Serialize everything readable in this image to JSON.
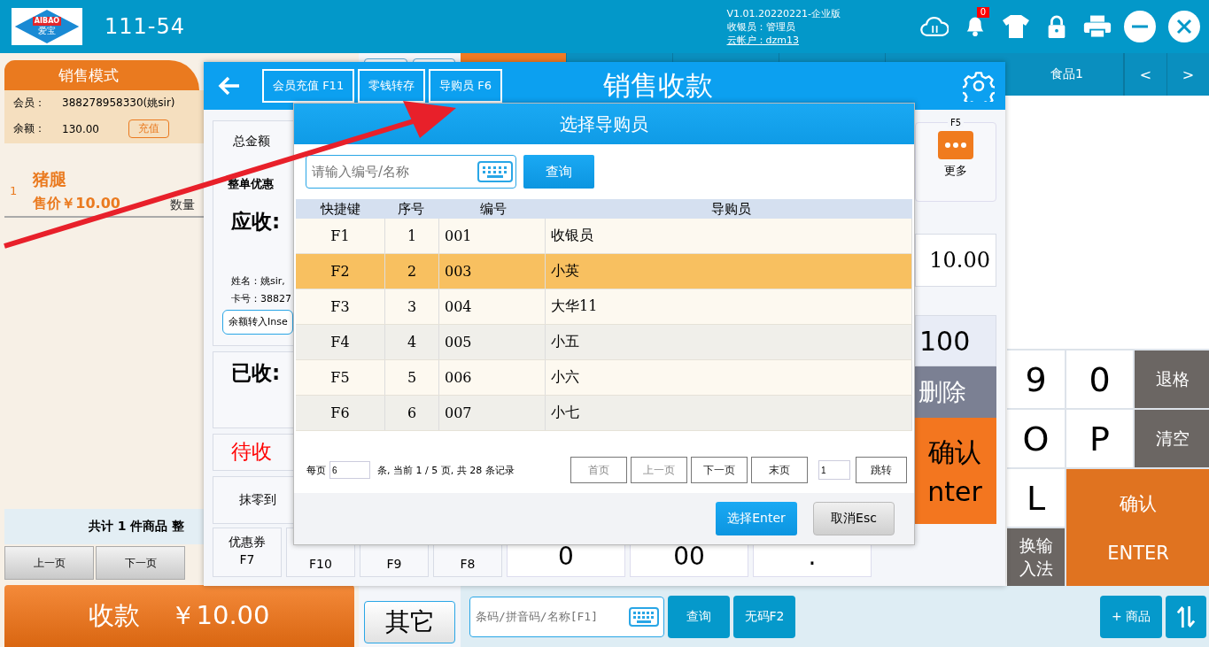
{
  "header": {
    "logo_text": "AIBAO",
    "logo_subtext": "爱宝",
    "title": "111-54",
    "version": "V1.01.20220221-企业版",
    "cashier": "收银员：管理员",
    "cloud_account": "云帐户：dzm13",
    "notification_count": "0"
  },
  "sale_panel": {
    "mode_tab": "销售模式",
    "member_label": "会员：",
    "member_value": "388278958330(姚sir)",
    "balance_label": "余额：",
    "balance_value": "130.00",
    "recharge_button": "充值",
    "items": [
      {
        "index": "1",
        "name": "猪腿",
        "price": "售价￥10.00",
        "qty_label": "数量"
      }
    ],
    "summary": "共计 1 件商品 整",
    "page_buttons": [
      "上一页",
      "下一页"
    ],
    "pay_button": {
      "label": "收款",
      "amount": "￥10.00"
    }
  },
  "side_buttons": [
    "其它"
  ],
  "category_tabs": [
    {
      "selected": true
    },
    {
      "selected": false
    },
    {
      "selected": false
    },
    {
      "selected": false
    },
    {
      "label": "食品1",
      "selected": false
    }
  ],
  "category_nav": [
    "<",
    ">"
  ],
  "keypad": [
    {
      "kind": "char",
      "label": "9"
    },
    {
      "kind": "char",
      "label": "0"
    },
    {
      "kind": "action",
      "label": "退格"
    },
    {
      "kind": "char",
      "label": "O"
    },
    {
      "kind": "char",
      "label": "P"
    },
    {
      "kind": "action",
      "label": "清空"
    },
    {
      "kind": "char",
      "label": "L"
    },
    {
      "kind": "confirm",
      "lines": [
        "确认",
        "ENTER"
      ]
    },
    {
      "kind": "action",
      "label": "换输入法"
    }
  ],
  "bottom_bar": {
    "search_placeholder": "条码/拼音码/名称[F1]",
    "query_button": "查询",
    "no_code_button": "无码F2",
    "add_button": "+ 商品"
  },
  "payment_window": {
    "title": "销售收款",
    "toolbar_buttons": [
      "会员充值 F11",
      "零钱转存",
      "导购员 F6"
    ],
    "total_label": "总金额",
    "discount_label": "整单优惠",
    "receivable_label": "应收:",
    "member_name": "姓名：姚sir,",
    "card_no": "卡号：38827",
    "balance_transfer_button": "余额转入Inse",
    "received_label": "已收:",
    "pending_label": "待收",
    "round_label": "抹零到",
    "function_keys": [
      {
        "label": "优惠券",
        "key": "F7"
      },
      {
        "key": "F10"
      },
      {
        "key": "F9"
      },
      {
        "key": "F8"
      }
    ],
    "more_button": {
      "key": "F5",
      "label": "更多"
    },
    "amount_value": "10.00",
    "quick_amount": "100",
    "delete_key": "删除",
    "confirm_key": [
      "确认",
      "nter"
    ],
    "keypad_row": [
      "0",
      "00",
      "."
    ]
  },
  "dialog": {
    "title": "选择导购员",
    "search_placeholder": "请输入编号/名称",
    "search_button": "查询",
    "columns": [
      "快捷键",
      "序号",
      "编号",
      "导购员"
    ],
    "rows": [
      {
        "cells": [
          "F1",
          "1",
          "001",
          "收银员"
        ],
        "selected": false
      },
      {
        "cells": [
          "F2",
          "2",
          "003",
          "小英"
        ],
        "selected": true
      },
      {
        "cells": [
          "F3",
          "3",
          "004",
          "大华11"
        ],
        "selected": false
      },
      {
        "cells": [
          "F4",
          "4",
          "005",
          "小五"
        ],
        "selected": false
      },
      {
        "cells": [
          "F5",
          "5",
          "006",
          "小六"
        ],
        "selected": false
      },
      {
        "cells": [
          "F6",
          "6",
          "007",
          "小七"
        ],
        "selected": false
      }
    ],
    "page_size_label": "每页",
    "page_size": "6",
    "page_info": "条, 当前 1 / 5 页, 共 28 条记录",
    "page_buttons": [
      {
        "label": "首页",
        "disabled": true
      },
      {
        "label": "上一页",
        "disabled": true
      },
      {
        "label": "下一页",
        "disabled": false
      },
      {
        "label": "末页",
        "disabled": false
      }
    ],
    "page_input": "1",
    "jump_button": "跳转",
    "select_button": "选择Enter",
    "cancel_button": "取消Esc"
  }
}
